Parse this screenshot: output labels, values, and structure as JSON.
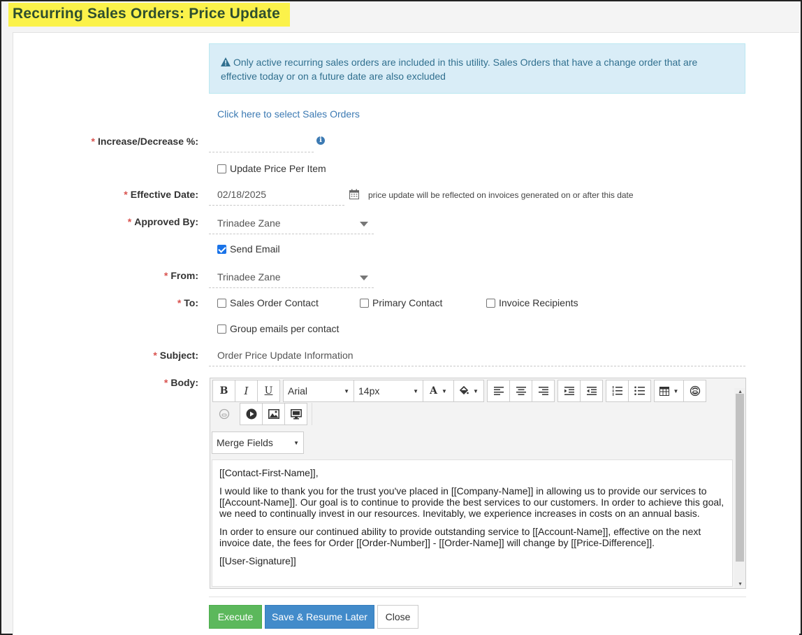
{
  "page": {
    "title": "Recurring Sales Orders: Price Update"
  },
  "alert": {
    "text": "Only active recurring sales orders are included in this utility. Sales Orders that have a change order that are effective today or on a future date are also excluded"
  },
  "select_link": "Click here to select Sales Orders",
  "required_marker": "*",
  "form": {
    "increase_label": "Increase/Decrease %:",
    "increase_value": "",
    "update_per_item_label": "Update Price Per Item",
    "update_per_item_checked": false,
    "effective_label": "Effective Date:",
    "effective_value": "02/18/2025",
    "effective_hint": "price update will be reflected on invoices generated on or after this date",
    "approved_label": "Approved By:",
    "approved_value": "Trinadee Zane",
    "send_email_label": "Send Email",
    "send_email_checked": true,
    "from_label": "From:",
    "from_value": "Trinadee Zane",
    "to_label": "To:",
    "to_options": [
      {
        "label": "Sales Order Contact",
        "checked": false
      },
      {
        "label": "Primary Contact",
        "checked": false
      },
      {
        "label": "Invoice Recipients",
        "checked": false
      }
    ],
    "group_emails_label": "Group emails per contact",
    "group_emails_checked": false,
    "subject_label": "Subject:",
    "subject_value": "Order Price Update Information",
    "body_label": "Body:"
  },
  "editor": {
    "font_family": "Arial",
    "font_size": "14px",
    "bold": "B",
    "italic": "I",
    "underline": "U",
    "font_color": "A",
    "merge_fields": "Merge Fields",
    "body": [
      "[[Contact-First-Name]],",
      "I would like to thank you for the trust you've placed in [[Company-Name]] in allowing us to provide our services to [[Account-Name]]. Our goal is to continue to provide the best services to our customers. In order to achieve this goal, we need to continually invest in our resources. Inevitably, we experience increases in costs on an annual basis.",
      "In order to ensure our continued ability to provide outstanding service to [[Account-Name]], effective on the next invoice date, the fees for Order [[Order-Number]] - [[Order-Name]] will change by [[Price-Difference]].",
      "[[User-Signature]]"
    ]
  },
  "buttons": {
    "execute": "Execute",
    "save_resume": "Save & Resume Later",
    "close": "Close"
  },
  "colors": {
    "title_highlight": "#fbf24a",
    "required": "#d9534f",
    "alert_bg": "#d9edf7",
    "link": "#3c7ab3",
    "execute": "#5cb85c",
    "save": "#428bca"
  }
}
